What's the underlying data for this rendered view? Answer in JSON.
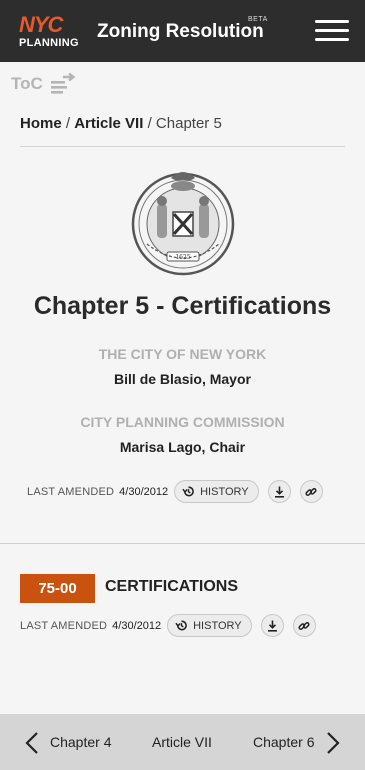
{
  "header": {
    "logo_top": "NYC",
    "logo_bottom": "PLANNING",
    "title": "Zoning Resolution",
    "badge": "BETA",
    "menu_icon": "hamburger-icon"
  },
  "toc": {
    "label": "ToC",
    "icon": "toc-toggle-icon"
  },
  "breadcrumb": {
    "home": "Home",
    "sep1": "/",
    "article": "Article VII",
    "sep2": "/",
    "current": "Chapter 5"
  },
  "seal": {
    "icon": "nyc-seal-image"
  },
  "chapter": {
    "title": "Chapter 5 - Certifications",
    "city": "THE CITY OF NEW YORK",
    "mayor": "Bill de Blasio, Mayor",
    "commission": "CITY PLANNING COMMISSION",
    "chair": "Marisa Lago, Chair",
    "last_amended_label": "LAST AMENDED",
    "last_amended_date": "4/30/2012",
    "history_label": "HISTORY"
  },
  "section": {
    "number": "75-00",
    "title": "CERTIFICATIONS",
    "last_amended_label": "LAST AMENDED",
    "last_amended_date": "4/30/2012",
    "history_label": "HISTORY"
  },
  "footer": {
    "prev": "Chapter 4",
    "middle": "Article VII",
    "next": "Chapter 6"
  },
  "colors": {
    "header_bg": "#2d2d2d",
    "brand_orange": "#e8592b",
    "section_badge": "#c9520f",
    "footer_bg": "#d5d5d5"
  }
}
